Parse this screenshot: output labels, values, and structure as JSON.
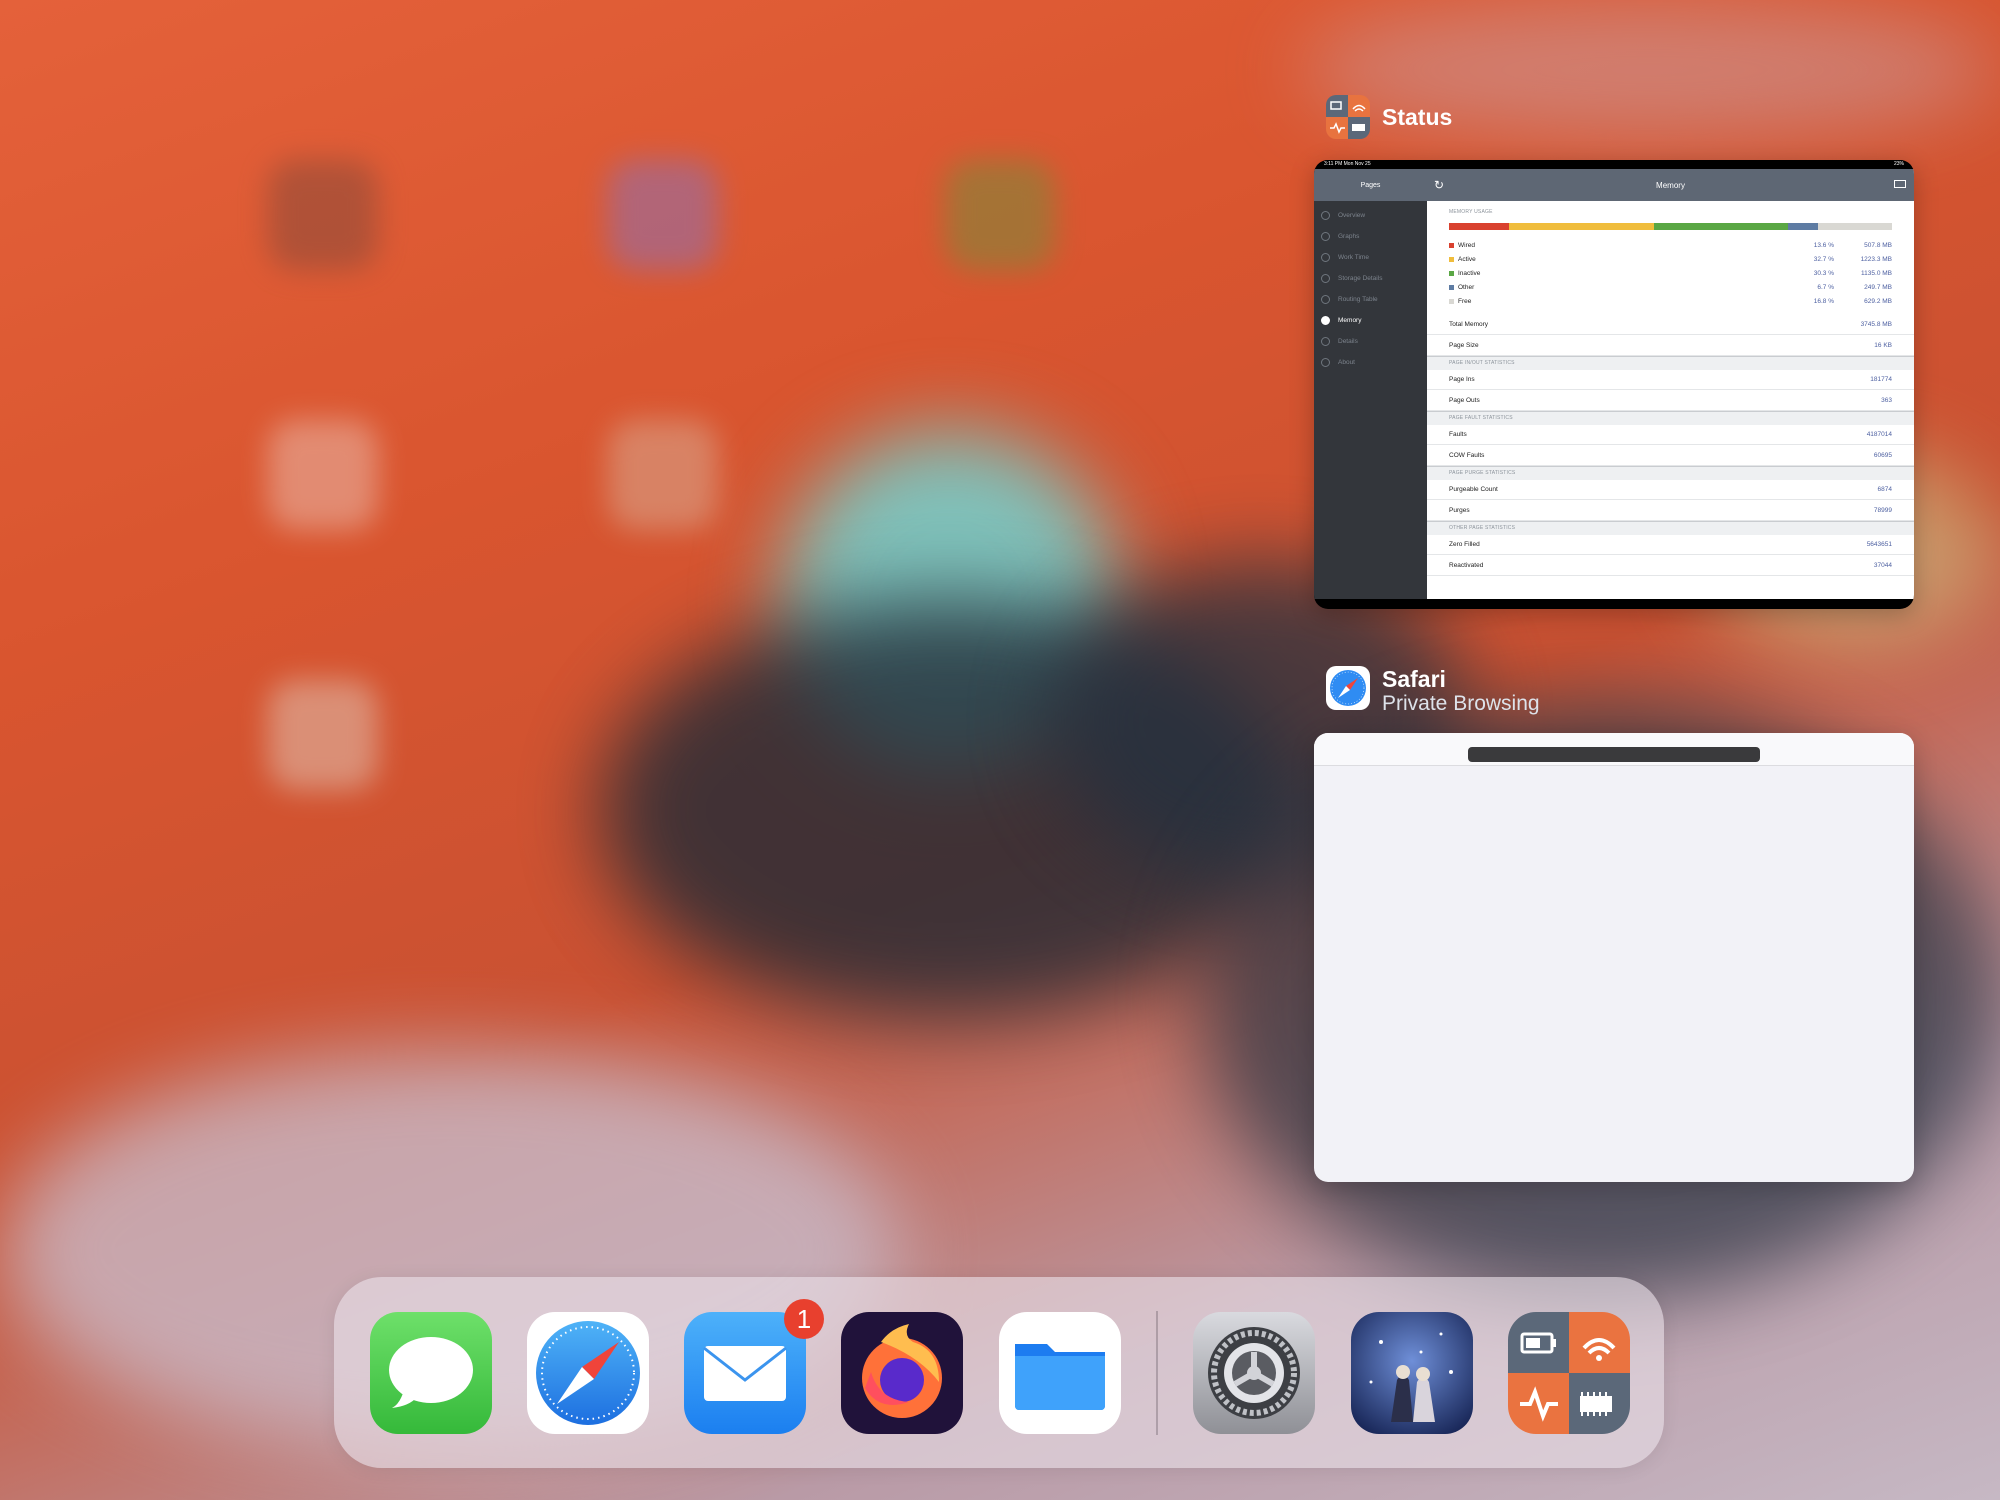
{
  "switcher": {
    "status_app": {
      "title": "Status",
      "window": {
        "status_bar_left": "3:11 PM   Mon Nov 25",
        "status_bar_right": "23%",
        "sidebar_title": "Pages",
        "sidebar_items": [
          {
            "label": "Overview",
            "active": false
          },
          {
            "label": "Graphs",
            "active": false
          },
          {
            "label": "Work Time",
            "active": false
          },
          {
            "label": "Storage Details",
            "active": false
          },
          {
            "label": "Routing Table",
            "active": false
          },
          {
            "label": "Memory",
            "active": true
          },
          {
            "label": "Details",
            "active": false
          },
          {
            "label": "About",
            "active": false
          }
        ],
        "page_title": "Memory",
        "memory_usage_header": "MEMORY USAGE",
        "memory_bar": [
          {
            "name": "Wired",
            "fraction": 0.136,
            "color": "#d9412f"
          },
          {
            "name": "Active",
            "fraction": 0.327,
            "color": "#f0bd3c"
          },
          {
            "name": "Inactive",
            "fraction": 0.303,
            "color": "#5aa744"
          },
          {
            "name": "Other",
            "fraction": 0.067,
            "color": "#5e7ca3"
          },
          {
            "name": "Free",
            "fraction": 0.168,
            "color": "#d9d8d3"
          }
        ],
        "memory_rows": [
          {
            "name": "Wired",
            "percent": "13.6 %",
            "value": "507.8 MB",
            "color": "#d9412f"
          },
          {
            "name": "Active",
            "percent": "32.7 %",
            "value": "1223.3 MB",
            "color": "#f0bd3c"
          },
          {
            "name": "Inactive",
            "percent": "30.3 %",
            "value": "1135.0 MB",
            "color": "#5aa744"
          },
          {
            "name": "Other",
            "percent": "6.7 %",
            "value": "249.7 MB",
            "color": "#5e7ca3"
          },
          {
            "name": "Free",
            "percent": "16.8 %",
            "value": "629.2 MB",
            "color": "#d9d8d3"
          }
        ],
        "total_memory": {
          "label": "Total Memory",
          "value": "3745.8 MB"
        },
        "page_size": {
          "label": "Page Size",
          "value": "16 KB"
        },
        "sections": [
          {
            "header": "PAGE IN/OUT STATISTICS",
            "rows": [
              {
                "label": "Page Ins",
                "value": "181774"
              },
              {
                "label": "Page Outs",
                "value": "363"
              }
            ]
          },
          {
            "header": "PAGE FAULT STATISTICS",
            "rows": [
              {
                "label": "Faults",
                "value": "4187014"
              },
              {
                "label": "COW Faults",
                "value": "60695"
              }
            ]
          },
          {
            "header": "PAGE PURGE STATISTICS",
            "rows": [
              {
                "label": "Purgeable Count",
                "value": "6874"
              },
              {
                "label": "Purges",
                "value": "78999"
              }
            ]
          },
          {
            "header": "OTHER PAGE STATISTICS",
            "rows": [
              {
                "label": "Zero Filled",
                "value": "5643651"
              },
              {
                "label": "Reactivated",
                "value": "37044"
              }
            ]
          }
        ]
      }
    },
    "safari_app": {
      "title": "Safari",
      "subtitle": "Private Browsing"
    }
  },
  "dock": {
    "apps": [
      {
        "name": "Messages",
        "icon": "messages-icon"
      },
      {
        "name": "Safari",
        "icon": "safari-icon"
      },
      {
        "name": "Mail",
        "icon": "mail-icon",
        "badge": "1"
      },
      {
        "name": "Firefox",
        "icon": "firefox-icon"
      },
      {
        "name": "Files",
        "icon": "files-icon"
      },
      {
        "name": "Settings",
        "icon": "settings-gear-icon"
      },
      {
        "name": "Sky",
        "icon": "sky-game-icon"
      },
      {
        "name": "Status",
        "icon": "status-app-icon"
      }
    ]
  }
}
